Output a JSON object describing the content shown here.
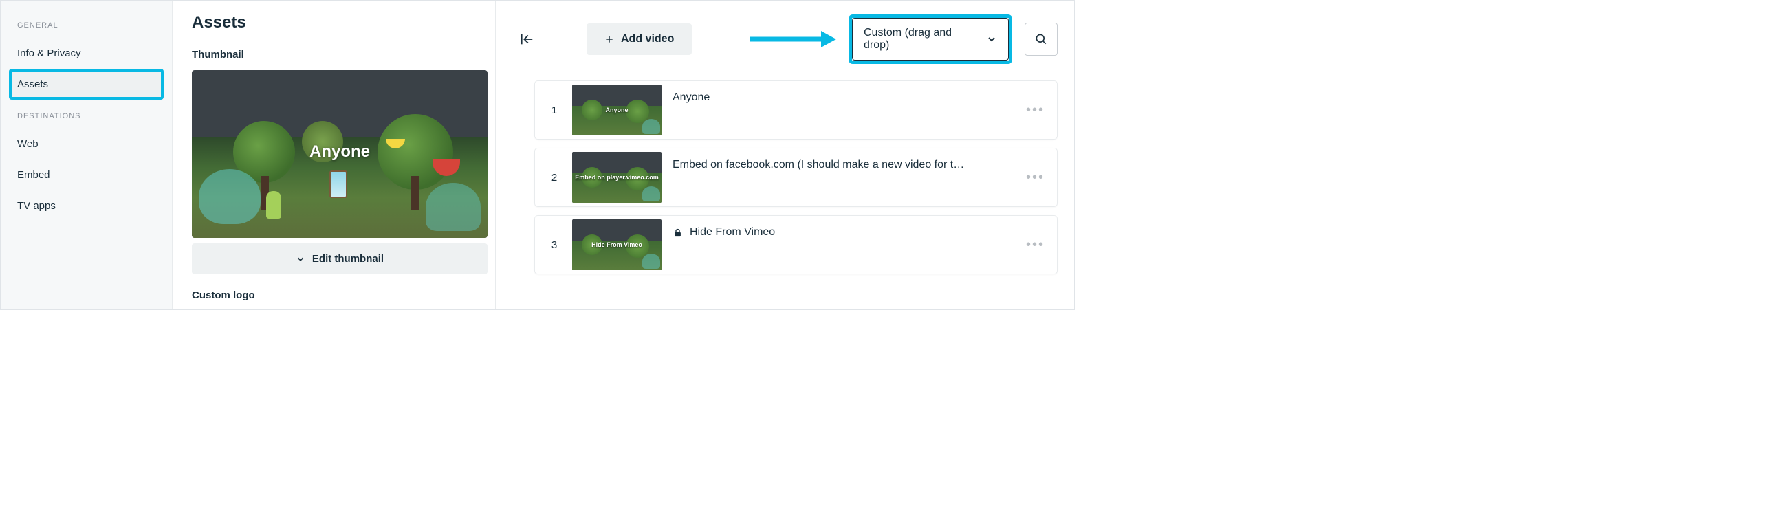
{
  "sidebar": {
    "section1_label": "GENERAL",
    "items1": [
      {
        "label": "Info & Privacy"
      },
      {
        "label": "Assets"
      }
    ],
    "section2_label": "DESTINATIONS",
    "items2": [
      {
        "label": "Web"
      },
      {
        "label": "Embed"
      },
      {
        "label": "TV apps"
      }
    ]
  },
  "mid": {
    "title": "Assets",
    "thumbnail_label": "Thumbnail",
    "thumb_overlay_title": "Anyone",
    "edit_thumbnail_label": "Edit thumbnail",
    "custom_logo_label": "Custom logo"
  },
  "right": {
    "add_video_label": "Add video",
    "sort_value": "Custom (drag and drop)",
    "videos": [
      {
        "num": "1",
        "title": "Anyone",
        "thumb_text": "Anyone",
        "locked": false
      },
      {
        "num": "2",
        "title": "Embed on facebook.com (I should make a new video for t…",
        "thumb_text": "Embed on player.vimeo.com",
        "locked": false
      },
      {
        "num": "3",
        "title": "Hide From Vimeo",
        "thumb_text": "Hide From Vimeo",
        "locked": true
      }
    ]
  }
}
